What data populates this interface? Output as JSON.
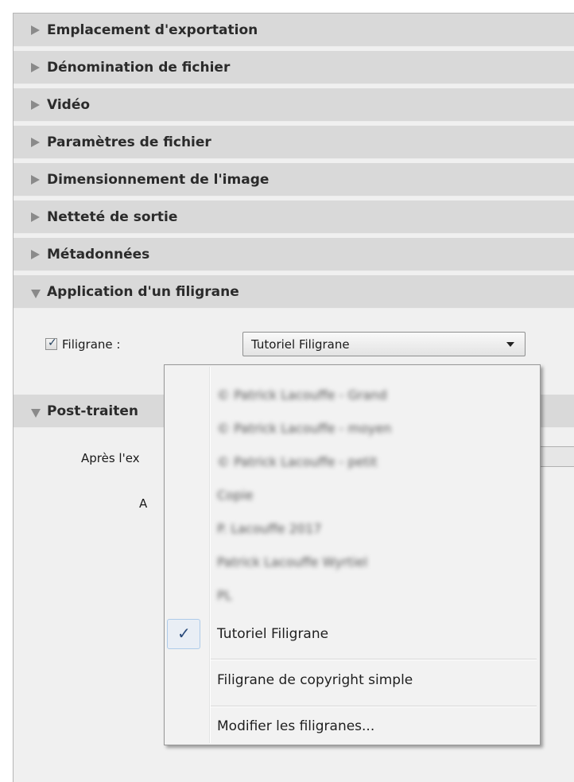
{
  "sections": [
    {
      "title": "Emplacement d'exportation",
      "expanded": false
    },
    {
      "title": "Dénomination de fichier",
      "expanded": false
    },
    {
      "title": "Vidéo",
      "expanded": false
    },
    {
      "title": "Paramètres de fichier",
      "expanded": false
    },
    {
      "title": "Dimensionnement de l'image",
      "expanded": false
    },
    {
      "title": "Netteté de sortie",
      "expanded": false
    },
    {
      "title": "Métadonnées",
      "expanded": false
    },
    {
      "title": "Application d'un filigrane",
      "expanded": true
    },
    {
      "title": "Post-traiten",
      "expanded": true
    }
  ],
  "watermark": {
    "checkbox_checked": true,
    "checkbox_label": "Filigrane :",
    "selected": "Tutoriel Filigrane"
  },
  "post_processing": {
    "after_export_label": "Après l'ex",
    "second_label": "A"
  },
  "menu": {
    "items": [
      {
        "label": "© Patrick Lacouffe - Grand",
        "obscured": true
      },
      {
        "label": "© Patrick Lacouffe - moyen",
        "obscured": true
      },
      {
        "label": "© Patrick Lacouffe - petit",
        "obscured": true
      },
      {
        "label": "Copie",
        "obscured": true
      },
      {
        "label": "P. Lacouffe 2017",
        "obscured": true
      },
      {
        "label": "Patrick Lacouffe Wyrtiel",
        "obscured": true
      },
      {
        "label": "PL",
        "obscured": true
      },
      {
        "label": "Tutoriel Filigrane",
        "checked": true
      },
      {
        "label": "Filigrane de copyright simple"
      },
      {
        "label": "Modifier les filigranes..."
      }
    ],
    "check_glyph": "✓"
  }
}
